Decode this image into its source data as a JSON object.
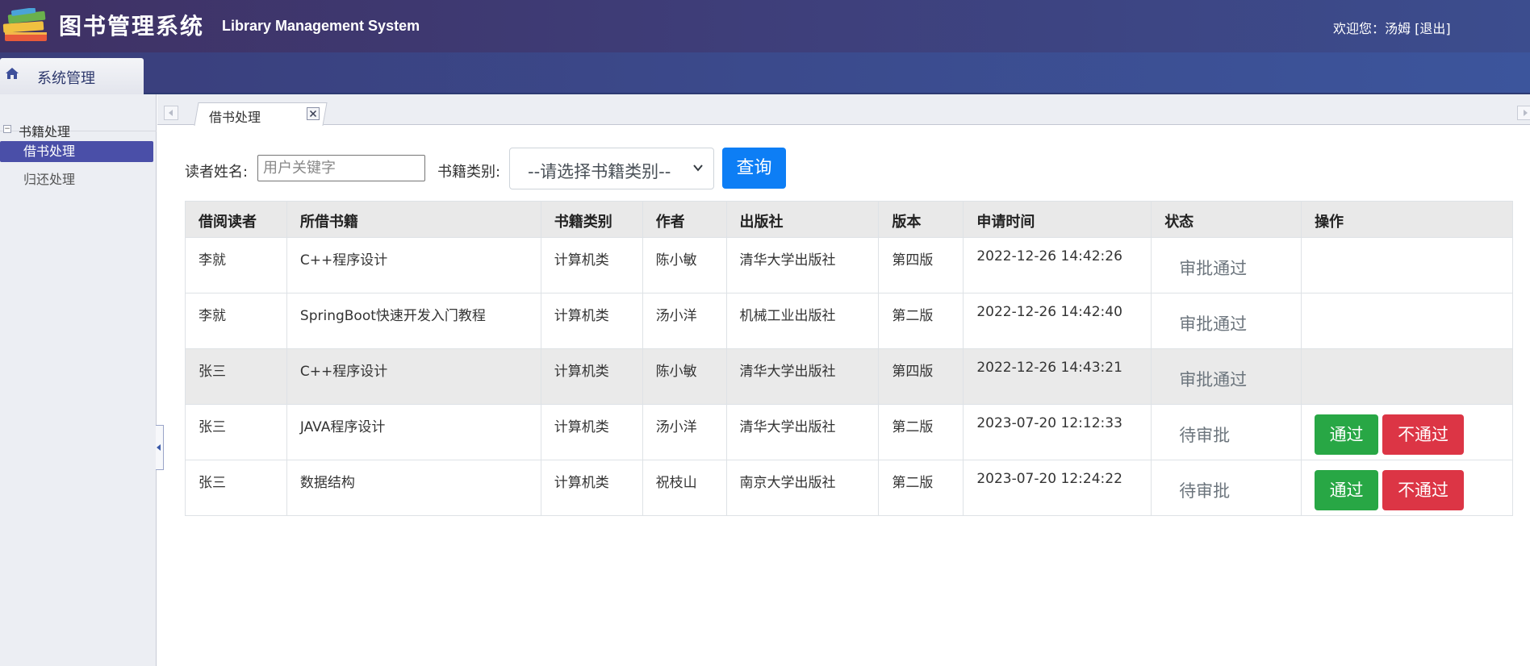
{
  "header": {
    "title": "图书管理系统",
    "subtitle": "Library Management System",
    "welcome_text": "欢迎您：汤姆",
    "logout_label": "[退出]"
  },
  "nav": {
    "system_tab_label": "系统管理"
  },
  "sidebar": {
    "group_label": "书籍处理",
    "items": [
      {
        "label": "借书处理",
        "active": true
      },
      {
        "label": "归还处理",
        "active": false
      }
    ]
  },
  "tabs": [
    {
      "label": "借书处理"
    }
  ],
  "search": {
    "reader_label": "读者姓名:",
    "reader_placeholder": "用户关键字",
    "reader_value": "",
    "category_label": "书籍类别:",
    "category_selected": "--请选择书籍类别--",
    "query_label": "查询"
  },
  "table": {
    "columns": [
      "借阅读者",
      "所借书籍",
      "书籍类别",
      "作者",
      "出版社",
      "版本",
      "申请时间",
      "状态",
      "操作"
    ],
    "rows": [
      {
        "reader": "李就",
        "book": "C++程序设计",
        "category": "计算机类",
        "author": "陈小敏",
        "publisher": "清华大学出版社",
        "edition": "第四版",
        "time": "2022-12-26 14:42:26",
        "status": "审批通过"
      },
      {
        "reader": "李就",
        "book": "SpringBoot快速开发入门教程",
        "category": "计算机类",
        "author": "汤小洋",
        "publisher": "机械工业出版社",
        "edition": "第二版",
        "time": "2022-12-26 14:42:40",
        "status": "审批通过"
      },
      {
        "reader": "张三",
        "book": "C++程序设计",
        "category": "计算机类",
        "author": "陈小敏",
        "publisher": "清华大学出版社",
        "edition": "第四版",
        "time": "2022-12-26 14:43:21",
        "status": "审批通过"
      },
      {
        "reader": "张三",
        "book": "JAVA程序设计",
        "category": "计算机类",
        "author": "汤小洋",
        "publisher": "清华大学出版社",
        "edition": "第二版",
        "time": "2023-07-20 12:12:33",
        "status": "待审批",
        "approve_label": "通过",
        "reject_label": "不通过"
      },
      {
        "reader": "张三",
        "book": "数据结构",
        "category": "计算机类",
        "author": "祝枝山",
        "publisher": "南京大学出版社",
        "edition": "第二版",
        "time": "2023-07-20 12:24:22",
        "status": "待审批",
        "approve_label": "通过",
        "reject_label": "不通过"
      }
    ]
  },
  "colors": {
    "header_bg": "#3f3164",
    "sidebar_active": "#4a4fa8",
    "primary": "#0d7ef5",
    "success": "#28a745",
    "danger": "#dc3545"
  }
}
